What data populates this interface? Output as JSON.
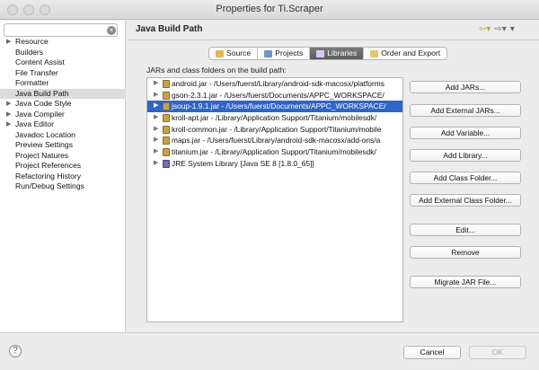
{
  "window": {
    "title": "Properties for Ti.Scraper"
  },
  "sidebar": {
    "filter_placeholder": "",
    "items": [
      {
        "label": "Resource",
        "expandable": true,
        "selected": false
      },
      {
        "label": "Builders",
        "expandable": false,
        "selected": false
      },
      {
        "label": "Content Assist",
        "expandable": false,
        "selected": false
      },
      {
        "label": "File Transfer",
        "expandable": false,
        "selected": false
      },
      {
        "label": "Formatter",
        "expandable": false,
        "selected": false
      },
      {
        "label": "Java Build Path",
        "expandable": false,
        "selected": true
      },
      {
        "label": "Java Code Style",
        "expandable": true,
        "selected": false
      },
      {
        "label": "Java Compiler",
        "expandable": true,
        "selected": false
      },
      {
        "label": "Java Editor",
        "expandable": true,
        "selected": false
      },
      {
        "label": "Javadoc Location",
        "expandable": false,
        "selected": false
      },
      {
        "label": "Preview Settings",
        "expandable": false,
        "selected": false
      },
      {
        "label": "Project Natures",
        "expandable": false,
        "selected": false
      },
      {
        "label": "Project References",
        "expandable": false,
        "selected": false
      },
      {
        "label": "Refactoring History",
        "expandable": false,
        "selected": false
      },
      {
        "label": "Run/Debug Settings",
        "expandable": false,
        "selected": false
      }
    ]
  },
  "main": {
    "title": "Java Build Path",
    "tabs": [
      {
        "label": "Source",
        "icon": "source-folder-icon",
        "active": false
      },
      {
        "label": "Projects",
        "icon": "projects-icon",
        "active": false
      },
      {
        "label": "Libraries",
        "icon": "libraries-icon",
        "active": true
      },
      {
        "label": "Order and Export",
        "icon": "order-export-icon",
        "active": false
      }
    ],
    "content_label": "JARs and class folders on the build path:",
    "entries": [
      {
        "label": "android.jar - /Users/fuerst/Library/android-sdk-macosx/platforms",
        "kind": "jar",
        "selected": false
      },
      {
        "label": "gson-2.3.1.jar - /Users/fuerst/Documents/APPC_WORKSPACE/",
        "kind": "jar",
        "selected": false
      },
      {
        "label": "jsoup-1.9.1.jar - /Users/fuerst/Documents/APPC_WORKSPACE/",
        "kind": "jar",
        "selected": true
      },
      {
        "label": "kroll-apt.jar - /Library/Application Support/Titanium/mobilesdk/",
        "kind": "jar",
        "selected": false
      },
      {
        "label": "kroll-common.jar - /Library/Application Support/Titanium/mobile",
        "kind": "jar",
        "selected": false
      },
      {
        "label": "maps.jar - /Users/fuerst/Library/android-sdk-macosx/add-ons/a",
        "kind": "jar",
        "selected": false
      },
      {
        "label": "titanium.jar - /Library/Application Support/Titanium/mobilesdk/",
        "kind": "jar",
        "selected": false
      },
      {
        "label": "JRE System Library [Java SE 8 [1.8.0_65]]",
        "kind": "library",
        "selected": false
      }
    ],
    "buttons": {
      "add_jars": "Add JARs...",
      "add_external_jars": "Add External JARs...",
      "add_variable": "Add Variable...",
      "add_library": "Add Library...",
      "add_class_folder": "Add Class Folder...",
      "add_external_class_folder": "Add External Class Folder...",
      "edit": "Edit...",
      "remove": "Remove",
      "migrate_jar": "Migrate JAR File..."
    }
  },
  "footer": {
    "help_glyph": "?",
    "cancel_label": "Cancel",
    "ok_label": "OK"
  },
  "colors": {
    "selection": "#2f64c9",
    "jar_icon": "#c8a24a",
    "library_icon": "#7f6bb0",
    "back_arrow": "#d4a017"
  }
}
